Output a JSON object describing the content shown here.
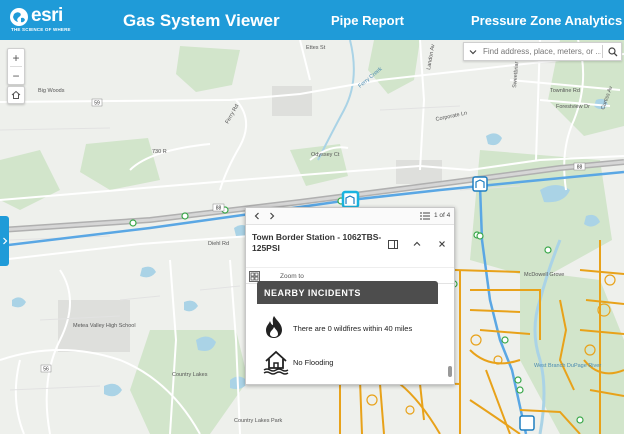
{
  "header": {
    "logo": {
      "word": "esri",
      "tagline": "THE SCIENCE OF WHERE"
    },
    "title": "Gas System Viewer",
    "nav": [
      {
        "label": "Pipe Report"
      },
      {
        "label": "Pressure Zone Analytics"
      }
    ]
  },
  "map": {
    "labels": {
      "big_woods": "Big Woods",
      "ferry_rd": "Ferry Rd",
      "odyssey_ct": "Odyssey Ct",
      "corporate_ln": "Corporate Ln",
      "ferry_creek": "Ferry Creek",
      "landon_av": "Landon Av",
      "ettes_st": "Ettes St",
      "diehl_rd": "Diehl Rd",
      "metea": "Metea Valley High School",
      "country_lakes": "Country Lakes",
      "country_lakes_park": "Country Lakes Park",
      "mcdowell_grove": "McDowell Grove",
      "west_branch": "West Branch DuPage River",
      "townline_rd": "Townline Rd",
      "forestview_dr": "Forestview Dr",
      "sweetbriar": "Sweetbriar",
      "curtiss_av": "Curtiss Av",
      "rd_730": "730 R",
      "route_88": "88",
      "route_59": "59",
      "route_56": "56"
    }
  },
  "controls": {
    "zoom_in": "+",
    "zoom_out": "−",
    "home_icon": "home-icon"
  },
  "search": {
    "placeholder": "Find address, place, meters, or ..."
  },
  "popup": {
    "page_count": "1 of 4",
    "title": "Town Border Station - 1062TBS-125PSI",
    "zoom_to": "Zoom to",
    "section_title": "NEARBY INCIDENTS",
    "incidents": [
      {
        "icon": "fire-icon",
        "text": "There are 0 wildfires within 40 miles"
      },
      {
        "icon": "flood-house-icon",
        "text": "No Flooding"
      }
    ]
  },
  "colors": {
    "header": "#1f9bd8",
    "pipe_orange": "#e8a21a",
    "pipe_blue": "#5aa7e4",
    "water": "#aad3e6",
    "vegetation": "#cfe2c8"
  }
}
